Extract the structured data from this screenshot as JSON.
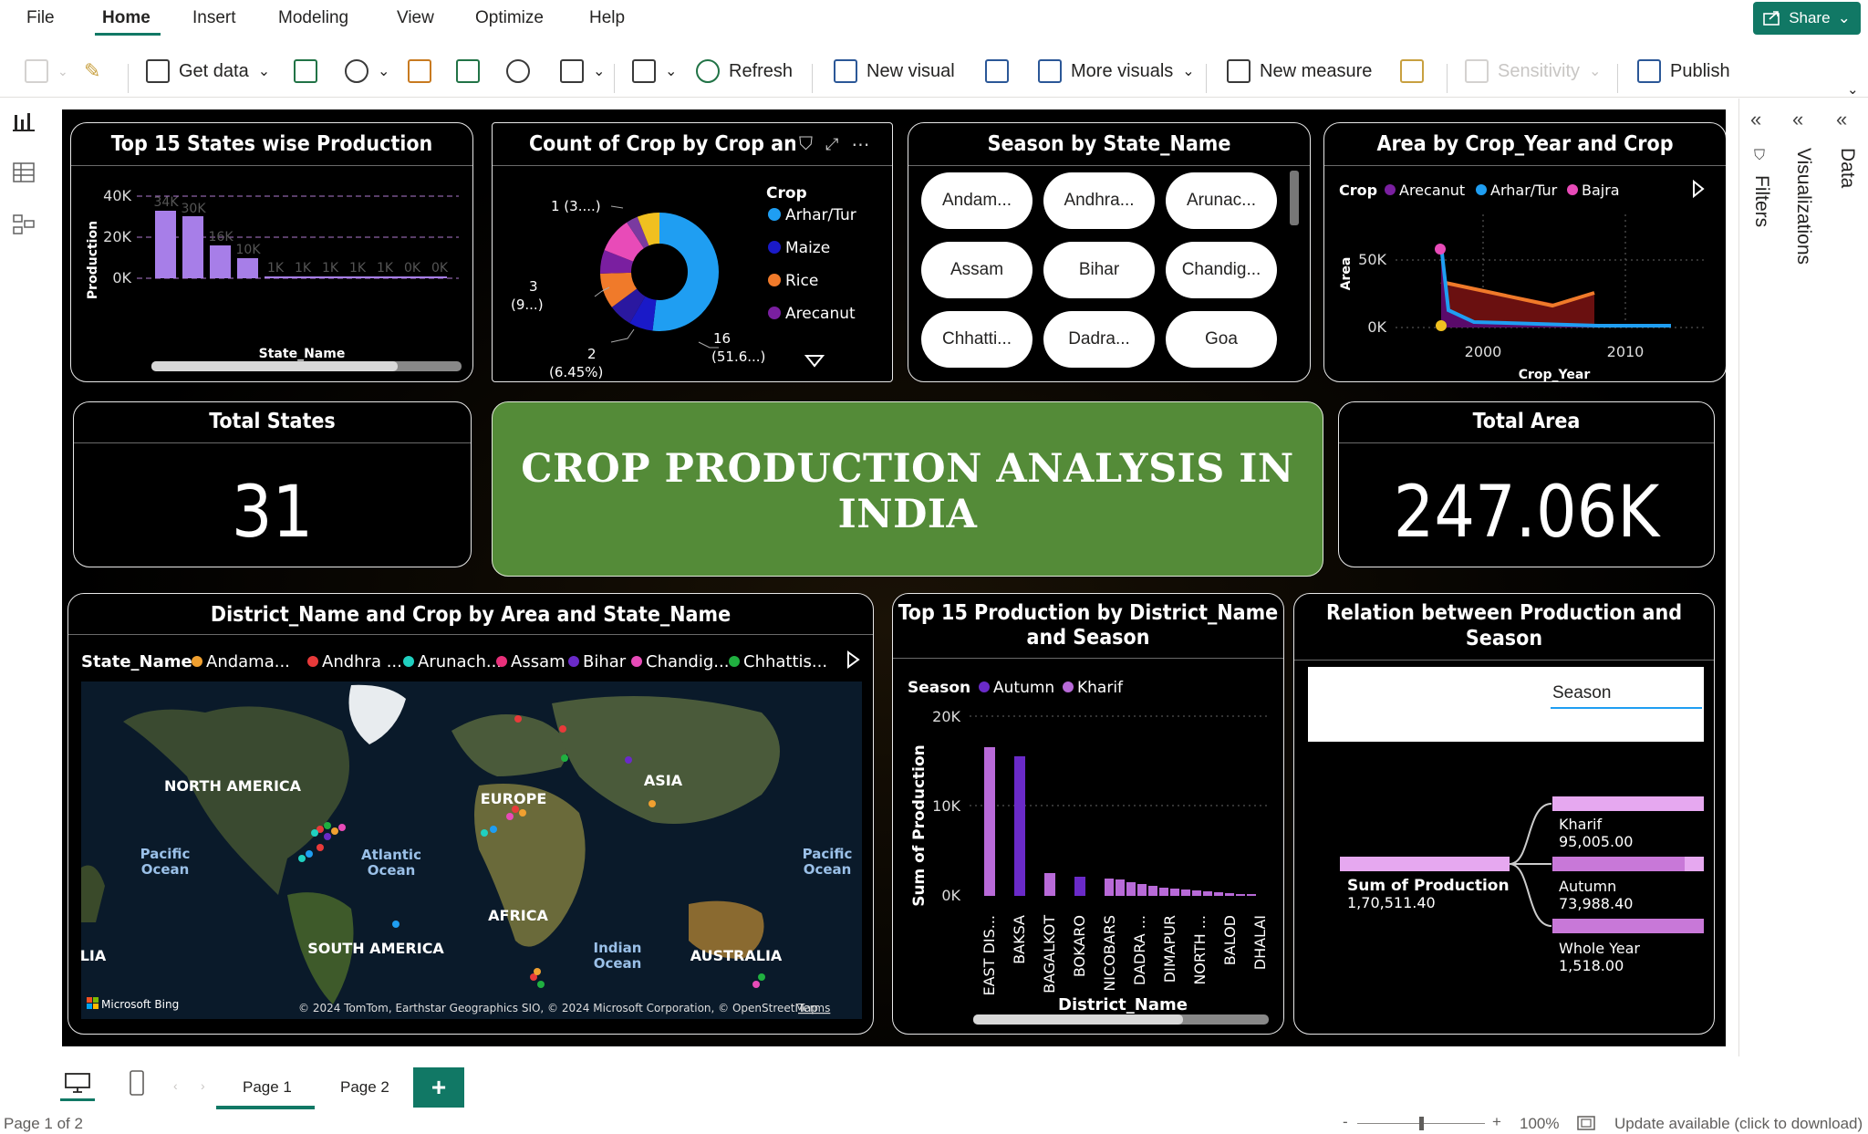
{
  "menu": {
    "items": [
      "File",
      "Home",
      "Insert",
      "Modeling",
      "View",
      "Optimize",
      "Help"
    ],
    "share": "Share"
  },
  "ribbon": {
    "get_data": "Get data",
    "refresh": "Refresh",
    "new_visual": "New visual",
    "more_visuals": "More visuals",
    "new_measure": "New measure",
    "sensitivity": "Sensitivity",
    "publish": "Publish"
  },
  "top_states": {
    "title": "Top 15 States wise Production",
    "ylabel": "Production",
    "xlabel": "State_Name",
    "yticks": [
      "40K",
      "20K",
      "0K"
    ],
    "data_labels": [
      "34K",
      "30K",
      "16K",
      "10K",
      "1K",
      "1K",
      "1K",
      "1K",
      "1K",
      "0K",
      "0K"
    ]
  },
  "crop_count": {
    "title": "Count of Crop by Crop and State_Name",
    "legend_title": "Crop",
    "legend": [
      "Arhar/Tur",
      "Maize",
      "Rice",
      "Arecanut"
    ],
    "labels": {
      "l1": "1 (3....)",
      "l3a": "3",
      "l3b": "(9...)",
      "l2a": "2",
      "l2b": "(6.45%)",
      "l16a": "16",
      "l16b": "(51.6...)"
    }
  },
  "season_state": {
    "title": "Season by State_Name",
    "pills": [
      "Andam...",
      "Andhra...",
      "Arunac...",
      "Assam",
      "Bihar",
      "Chandig...",
      "Chhatti...",
      "Dadra...",
      "Goa"
    ]
  },
  "area_year": {
    "title": "Area by Crop_Year and Crop",
    "legend_title": "Crop",
    "legend": [
      "Arecanut",
      "Arhar/Tur",
      "Bajra"
    ],
    "ylabel": "Area",
    "xlabel": "Crop_Year",
    "yticks": [
      "50K",
      "0K"
    ],
    "xticks": [
      "2000",
      "2010"
    ]
  },
  "total_states": {
    "title": "Total States",
    "value": "31"
  },
  "banner": {
    "text": "CROP PRODUCTION ANALYSIS IN INDIA"
  },
  "total_area": {
    "title": "Total Area",
    "value": "247.06K"
  },
  "map": {
    "title": "District_Name and Crop by Area and State_Name",
    "legend_title": "State_Name",
    "legend": [
      "Andama...",
      "Andhra ...",
      "Arunach...",
      "Assam",
      "Bihar",
      "Chandig...",
      "Chhattis..."
    ],
    "labels": {
      "na": "NORTH AMERICA",
      "eu": "EUROPE",
      "asia": "ASIA",
      "africa": "AFRICA",
      "sa": "SOUTH AMERICA",
      "au": "AUSTRALIA",
      "po1a": "Pacific",
      "po1b": "Ocean",
      "po2a": "Pacific",
      "po2b": "Ocean",
      "ao_a": "Atlantic",
      "ao_b": "Ocean",
      "io_a": "Indian",
      "io_b": "Ocean",
      "lia": "LIA"
    },
    "bing": "Microsoft Bing",
    "copyright": "© 2024 TomTom, Earthstar Geographics SIO, © 2024 Microsoft Corporation, © OpenStreetMap",
    "terms": "Terms"
  },
  "district": {
    "title1": "Top 15 Production by District_Name",
    "title2": "and Season",
    "legend_title": "Season",
    "legend": [
      "Autumn",
      "Kharif"
    ],
    "ylabel": "Sum of Production",
    "xlabel": "District_Name",
    "yticks": [
      "20K",
      "10K",
      "0K"
    ],
    "categories": [
      "EAST DIS...",
      "BAKSA",
      "BAGALKOT",
      "BOKARO",
      "NICOBARS",
      "DADRA ...",
      "DIMAPUR",
      "NORTH ...",
      "BALOD",
      "DHALAI"
    ]
  },
  "relation": {
    "title1": "Relation between Production and",
    "title2": "Season",
    "slicer_label": "Season",
    "root_label": "Sum of Production",
    "root_value": "1,70,511.40",
    "children": [
      {
        "label": "Kharif",
        "value": "95,005.00"
      },
      {
        "label": "Autumn",
        "value": "73,988.40"
      },
      {
        "label": "Whole Year",
        "value": "1,518.00"
      }
    ]
  },
  "right_pane": {
    "filters": "Filters",
    "visualizations": "Visualizations",
    "data": "Data"
  },
  "pages": {
    "page1": "Page 1",
    "page2": "Page 2",
    "add": "+"
  },
  "status": {
    "page_of": "Page 1 of 2",
    "zoom": "100%",
    "update": "Update available (click to download)",
    "minus": "-",
    "plus": "+"
  },
  "colors": {
    "accent": "#117865",
    "bar_purple": "#a77ee8",
    "banner": "#548b38",
    "arhar": "#1f9ef2",
    "maize": "#1a1ac8",
    "rice": "#f07a2a",
    "arecanut": "#7a1fa0",
    "bajra": "#e84bb8"
  }
}
